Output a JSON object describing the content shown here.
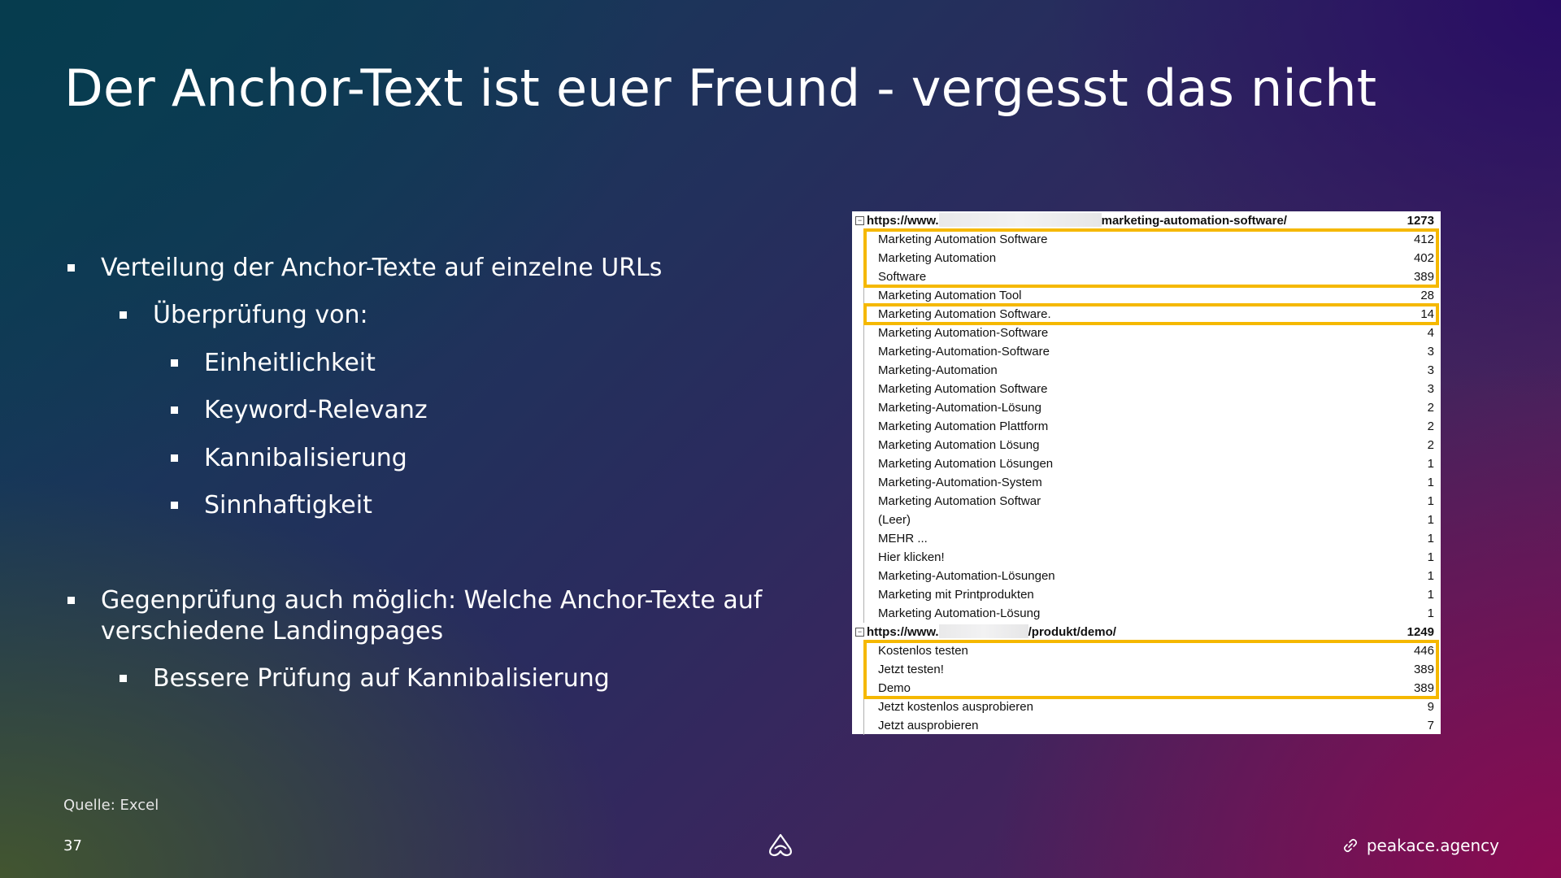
{
  "title": "Der Anchor-Text ist euer Freund - vergesst das nicht",
  "bullets": [
    {
      "level": 1,
      "text": "Verteilung der Anchor-Texte auf einzelne URLs"
    },
    {
      "level": 2,
      "text": "Überprüfung von:"
    },
    {
      "level": 3,
      "text": "Einheitlichkeit"
    },
    {
      "level": 3,
      "text": "Keyword-Relevanz"
    },
    {
      "level": 3,
      "text": "Kannibalisierung"
    },
    {
      "level": 3,
      "text": "Sinnhaftigkeit"
    },
    {
      "level": 1,
      "text": "Gegenprüfung auch möglich: Welche Anchor-Texte auf",
      "text2": "verschiedene Landingpages"
    },
    {
      "level": 2,
      "text": "Bessere Prüfung auf Kannibalisierung"
    }
  ],
  "source": "Quelle: Excel",
  "page_number": "37",
  "footer_link": "peakace.agency",
  "table": {
    "groups": [
      {
        "url_prefix": "https://www.",
        "url_suffix": "marketing-automation-software/",
        "total": "1273",
        "rows": [
          {
            "label": "Marketing Automation Software",
            "count": "412"
          },
          {
            "label": "Marketing Automation",
            "count": "402"
          },
          {
            "label": "Software",
            "count": "389"
          },
          {
            "label": "Marketing Automation Tool",
            "count": "28"
          },
          {
            "label": "Marketing Automation Software.",
            "count": "14"
          },
          {
            "label": "Marketing Automation-Software",
            "count": "4"
          },
          {
            "label": "Marketing-Automation-Software",
            "count": "3"
          },
          {
            "label": "Marketing-Automation",
            "count": "3"
          },
          {
            "label": "Marketing Automation Software",
            "count": "3"
          },
          {
            "label": "Marketing-Automation-Lösung",
            "count": "2"
          },
          {
            "label": "Marketing Automation Plattform",
            "count": "2"
          },
          {
            "label": "Marketing Automation Lösung",
            "count": "2"
          },
          {
            "label": "Marketing Automation Lösungen",
            "count": "1"
          },
          {
            "label": "Marketing-Automation-System",
            "count": "1"
          },
          {
            "label": "Marketing Automation Softwar",
            "count": "1"
          },
          {
            "label": "(Leer)",
            "count": "1"
          },
          {
            "label": "MEHR ...",
            "count": "1"
          },
          {
            "label": "Hier klicken!",
            "count": "1"
          },
          {
            "label": "Marketing-Automation-Lösungen",
            "count": "1"
          },
          {
            "label": "Marketing mit Printprodukten",
            "count": "1"
          },
          {
            "label": "Marketing Automation-Lösung",
            "count": "1"
          }
        ]
      },
      {
        "url_prefix": "https://www.",
        "url_suffix": "/produkt/demo/",
        "total": "1249",
        "rows": [
          {
            "label": "Kostenlos testen",
            "count": "446"
          },
          {
            "label": "Jetzt testen!",
            "count": "389"
          },
          {
            "label": "Demo",
            "count": "389"
          },
          {
            "label": "Jetzt kostenlos ausprobieren",
            "count": "9"
          },
          {
            "label": "Jetzt ausprobieren",
            "count": "7"
          }
        ]
      }
    ],
    "highlight_color": "#f5b800"
  }
}
